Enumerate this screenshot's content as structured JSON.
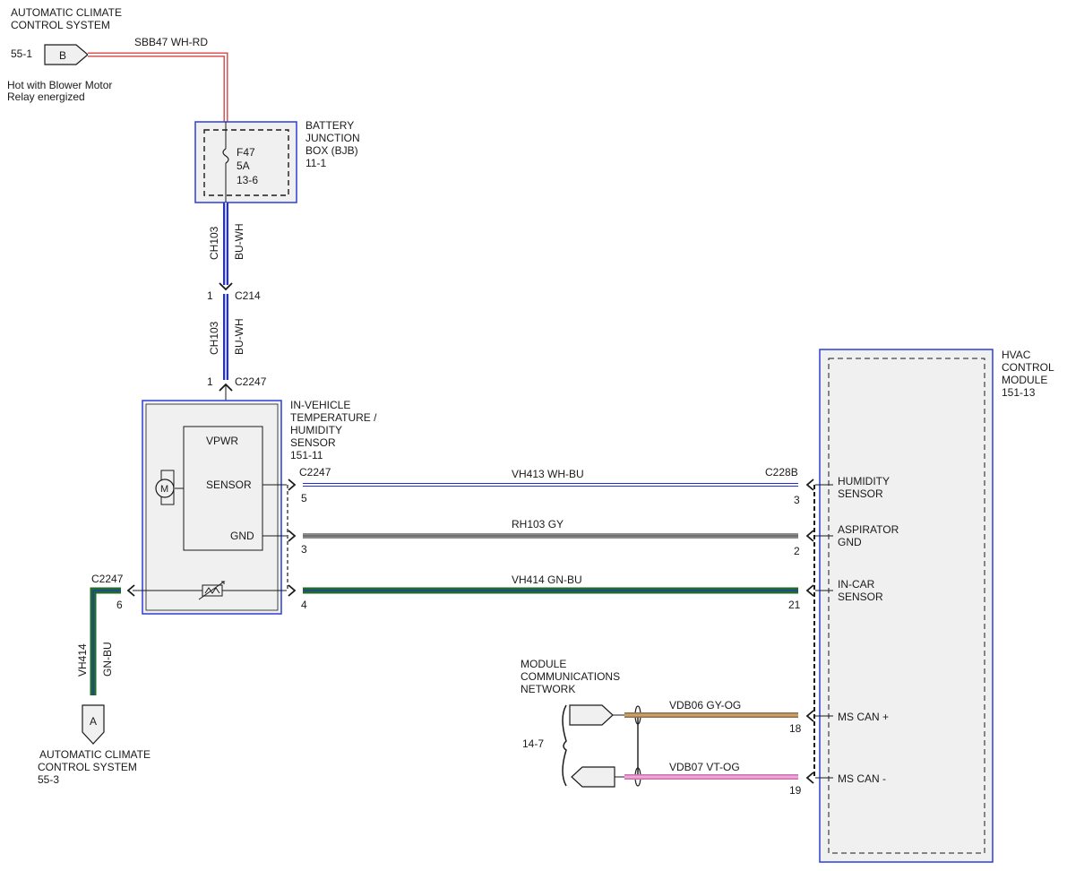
{
  "colors": {
    "line": "#1a1a1a",
    "box_border": "#2b3fd9",
    "box_fill": "#f0f0f0",
    "wire_bu": "#1f2ee0",
    "wire_wh": "#ffffff",
    "wire_rd": "#d64545",
    "wire_gy": "#8a8a8a",
    "wire_gn": "#1f6a2c",
    "wire_og": "#d0a060",
    "wire_vt": "#e890c8"
  },
  "top_connector": {
    "title_line1": "AUTOMATIC CLIMATE",
    "title_line2": "CONTROL SYSTEM",
    "ref": "55-1",
    "letter": "B",
    "note_line1": "Hot with Blower Motor",
    "note_line2": "Relay energized",
    "wire_label": "SBB47  WH-RD"
  },
  "bjb": {
    "title_line1": "BATTERY",
    "title_line2": "JUNCTION",
    "title_line3": "BOX (BJB)",
    "ref": "11-1",
    "fuse_name": "F47",
    "fuse_rating": "5A",
    "fuse_ref": "13-6"
  },
  "wire_ch103": {
    "circuit": "CH103",
    "color": "BU-WH"
  },
  "c214": {
    "pin": "1",
    "name": "C214"
  },
  "c2247_top": {
    "pin": "1",
    "name": "C2247"
  },
  "sensor_module": {
    "title_line1": "IN-VEHICLE",
    "title_line2": "TEMPERATURE /",
    "title_line3": "HUMIDITY",
    "title_line4": "SENSOR",
    "ref": "151-11",
    "motor": "M",
    "pin_vpwr": "VPWR",
    "pin_sensor": "SENSOR",
    "pin_gnd": "GND"
  },
  "hvac": {
    "title_line1": "HVAC",
    "title_line2": "CONTROL",
    "title_line3": "MODULE",
    "ref": "151-13",
    "humidity_line1": "HUMIDITY",
    "humidity_line2": "SENSOR",
    "aspirator_line1": "ASPIRATOR",
    "aspirator_line2": "GND",
    "incar_line1": "IN-CAR",
    "incar_line2": "SENSOR",
    "mscan_plus": "MS CAN +",
    "mscan_minus": "MS CAN -"
  },
  "wires": {
    "vh413": {
      "label": "VH413  WH-BU",
      "left_conn": "C2247",
      "right_conn": "C228B",
      "left_pin": "5",
      "right_pin": "3"
    },
    "rh103": {
      "label": "RH103  GY",
      "left_pin": "3",
      "right_pin": "2"
    },
    "vh414": {
      "label": "VH414  GN-BU",
      "left_pin": "4",
      "right_pin": "21"
    },
    "vdb06": {
      "label": "VDB06  GY-OG",
      "right_pin": "18"
    },
    "vdb07": {
      "label": "VDB07  VT-OG",
      "right_pin": "19"
    }
  },
  "left_branch": {
    "conn": "C2247",
    "pin": "6",
    "circuit": "VH414",
    "color": "GN-BU",
    "letter": "A",
    "title_line1": "AUTOMATIC CLIMATE",
    "title_line2": "CONTROL SYSTEM",
    "ref": "55-3"
  },
  "network": {
    "title_line1": "MODULE",
    "title_line2": "COMMUNICATIONS",
    "title_line3": "NETWORK",
    "ref": "14-7"
  }
}
